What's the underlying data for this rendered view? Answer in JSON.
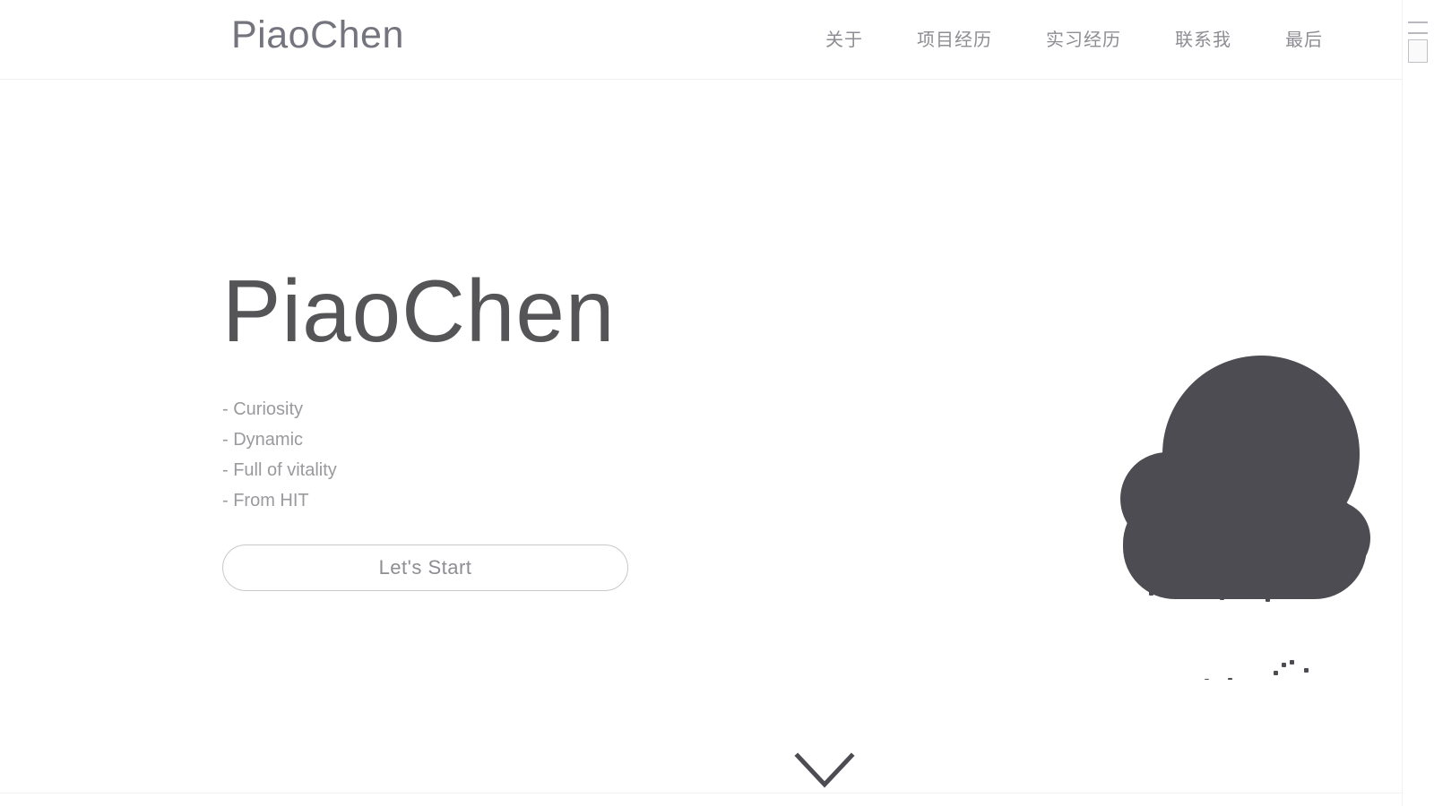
{
  "header": {
    "logo": "PiaoChen",
    "nav_items": [
      {
        "label": "关于",
        "name": "nav-item-about"
      },
      {
        "label": "项目经历",
        "name": "nav-item-projects"
      },
      {
        "label": "实习经历",
        "name": "nav-item-internship"
      },
      {
        "label": "联系我",
        "name": "nav-item-contact"
      },
      {
        "label": "最后",
        "name": "nav-item-final"
      }
    ]
  },
  "hero": {
    "title": "PiaoChen",
    "traits": [
      "- Curiosity",
      "- Dynamic",
      "- Full of vitality",
      "- From HIT"
    ],
    "cta_label": "Let's Start",
    "illustration": "cloud-with-rain",
    "scroll_hint_icon": "chevron-down-icon"
  },
  "colors": {
    "page_background": "#ffffff",
    "logo_text": "#74747e",
    "nav_text": "#8d8d93",
    "hero_title": "#555558",
    "trait_text": "#9a9a9e",
    "button_border": "#c9c9cd",
    "button_text": "#8d8d93",
    "cloud_fill": "#4c4c52",
    "raindrop_fill": "#4c4c52",
    "chevron_stroke": "#4c4c52",
    "header_rule": "#f0f0f2"
  }
}
